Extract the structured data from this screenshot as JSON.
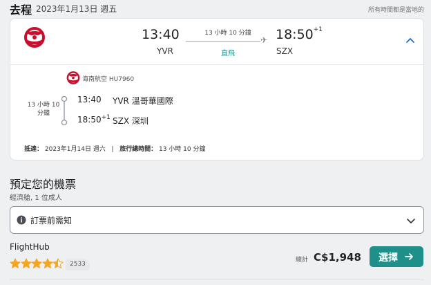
{
  "header": {
    "label": "去程",
    "date": "2023年1月13日 週五",
    "timezone_note": "所有時間都是當地的"
  },
  "flight": {
    "departure_time": "13:40",
    "departure_code": "YVR",
    "duration": "13 小時 10 分鐘",
    "stops": "直飛",
    "arrival_time": "18:50",
    "arrival_day_offset": "+1",
    "arrival_code": "SZX",
    "brand_color": "#c8102e"
  },
  "details": {
    "airline": "海南航空 HU7960",
    "duration": "13 小時 10 分鐘",
    "segments": [
      {
        "time": "13:40",
        "day_offset": "",
        "place": "YVR 溫哥華國際"
      },
      {
        "time": "18:50",
        "day_offset": "+1",
        "place": "SZX 深圳"
      }
    ],
    "arrival_label": "抵達：",
    "arrival_date": "2023年1月14日 週六",
    "separator": "|",
    "total_time_label": "旅行總時間：",
    "total_time": "13 小時 10 分鐘"
  },
  "booking": {
    "title": "預定您的機票",
    "cabin": "經濟艙, 1 位成人",
    "notice_label": "訂票前需知"
  },
  "offer": {
    "vendor": "FlightHub",
    "rating": 4.5,
    "reviews": "2533",
    "total_label": "總計",
    "price": "C$1,948",
    "select_label": "選擇",
    "accent_color": "#1f8f89",
    "star_color": "#f5a623"
  },
  "icons": {
    "airline_logo": "hainan-airlines-logo",
    "collapse": "chevron-up-icon",
    "info": "info-icon",
    "expand": "chevron-down-icon",
    "plane": "plane-icon",
    "arrow": "arrow-right-icon"
  }
}
